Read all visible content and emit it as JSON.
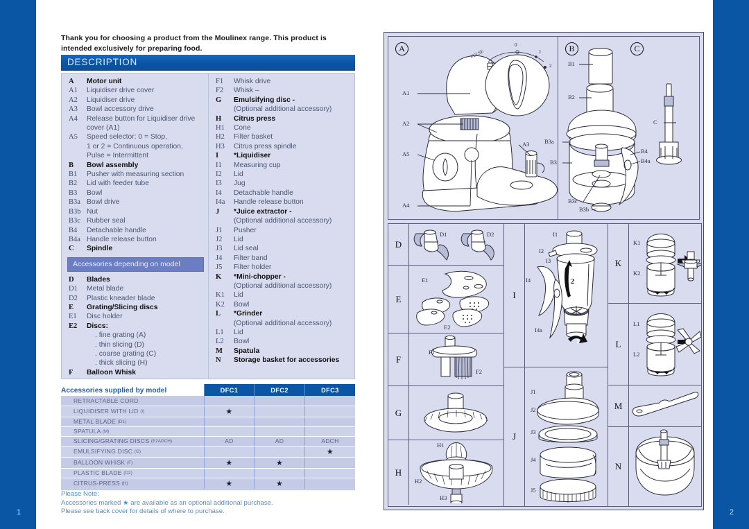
{
  "page": {
    "left_page_number": "1",
    "right_page_number": "2",
    "intro": "Thank you for choosing a product from the Moulinex range. This product is intended exclusively for preparing food.",
    "section_title": "DESCRIPTION"
  },
  "description": {
    "left_column": [
      {
        "code": "A",
        "text": "Motor unit",
        "bold": true
      },
      {
        "code": "A1",
        "text": "Liquidiser drive cover"
      },
      {
        "code": "A2",
        "text": "Liquidiser drive"
      },
      {
        "code": "A3",
        "text": "Bowl accessory drive"
      },
      {
        "code": "A4",
        "text": "Release button for Liquidiser drive"
      },
      {
        "code": "",
        "text": "cover (A1)"
      },
      {
        "code": "A5",
        "text": "Speed selector: 0 = Stop,"
      },
      {
        "code": "",
        "text": "1 or 2 = Continuous operation,"
      },
      {
        "code": "",
        "text": "Pulse = Intermittent"
      },
      {
        "code": "B",
        "text": "Bowl assembly",
        "bold": true
      },
      {
        "code": "B1",
        "text": "Pusher with measuring section"
      },
      {
        "code": "B2",
        "text": "Lid with feeder tube"
      },
      {
        "code": "B3",
        "text": "Bowl"
      },
      {
        "code": "B3a",
        "text": "Bowl drive"
      },
      {
        "code": "B3b",
        "text": "Nut"
      },
      {
        "code": "B3c",
        "text": "Rubber seal"
      },
      {
        "code": "B4",
        "text": "Detachable handle"
      },
      {
        "code": "B4a",
        "text": "Handle release button"
      },
      {
        "code": "C",
        "text": "Spindle",
        "bold": true
      }
    ],
    "band_label": "Accessories depending on model",
    "left_column_after_band": [
      {
        "code": "D",
        "text": "Blades",
        "bold": true
      },
      {
        "code": "D1",
        "text": "Metal blade"
      },
      {
        "code": "D2",
        "text": "Plastic kneader blade"
      },
      {
        "code": "E",
        "text": "Grating/Slicing discs",
        "bold": true
      },
      {
        "code": "E1",
        "text": "Disc holder"
      },
      {
        "code": "E2",
        "text": "Discs:",
        "bold": true
      },
      {
        "code": "",
        "text": ". fine grating (A)",
        "sub": true
      },
      {
        "code": "",
        "text": ". thin slicing (D)",
        "sub": true
      },
      {
        "code": "",
        "text": ". coarse grating (C)",
        "sub": true
      },
      {
        "code": "",
        "text": ". thick slicing (H)",
        "sub": true
      },
      {
        "code": "F",
        "text": "Balloon Whisk",
        "bold": true
      }
    ],
    "right_column": [
      {
        "code": "F1",
        "text": "Whisk drive"
      },
      {
        "code": "F2",
        "text": "Whisk –"
      },
      {
        "code": "G",
        "text": "Emulsifying disc -",
        "bold": true
      },
      {
        "code": "",
        "text": "(Optional additional accessory)"
      },
      {
        "code": "H",
        "text": "Citrus press",
        "bold": true
      },
      {
        "code": "H1",
        "text": "Cone"
      },
      {
        "code": "H2",
        "text": "Filter basket"
      },
      {
        "code": "H3",
        "text": "Citrus press spindle"
      },
      {
        "code": "I",
        "text": "*Liquidiser",
        "bold": true
      },
      {
        "code": "I1",
        "text": "Measuring cup"
      },
      {
        "code": "I2",
        "text": "Lid"
      },
      {
        "code": "I3",
        "text": "Jug"
      },
      {
        "code": "I4",
        "text": "Detachable handle"
      },
      {
        "code": "I4a",
        "text": "Handle release button"
      },
      {
        "code": "J",
        "text": "*Juice extractor -",
        "bold": true
      },
      {
        "code": "",
        "text": "(Optional additional accessory)"
      },
      {
        "code": "J1",
        "text": "Pusher"
      },
      {
        "code": "J2",
        "text": "Lid"
      },
      {
        "code": "J3",
        "text": "Lid seal"
      },
      {
        "code": "J4",
        "text": "Filter band"
      },
      {
        "code": "J5",
        "text": "Filter holder"
      },
      {
        "code": "K",
        "text": "*Mini-chopper -",
        "bold": true
      },
      {
        "code": "",
        "text": "(Optional additional accessory)"
      },
      {
        "code": "K1",
        "text": "Lid"
      },
      {
        "code": "K2",
        "text": "Bowl"
      },
      {
        "code": "L",
        "text": "*Grinder",
        "bold": true
      },
      {
        "code": "",
        "text": "(Optional additional accessory)"
      },
      {
        "code": "L1",
        "text": "Lid"
      },
      {
        "code": "L2",
        "text": "Bowl"
      },
      {
        "code": "M",
        "text": "Spatula",
        "bold": true
      },
      {
        "code": "N",
        "text": "Storage basket for accessories",
        "bold": true
      }
    ]
  },
  "accessories_table": {
    "title": "Accessories supplied by model",
    "columns": [
      "DFC1",
      "DFC2",
      "DFC3"
    ],
    "rows": [
      {
        "label": "RETRACTABLE CORD",
        "sub": "",
        "values": [
          "",
          "",
          ""
        ]
      },
      {
        "label": "LIQUIDISER WITH LID",
        "sub": "(I)",
        "values": [
          "★",
          "",
          ""
        ]
      },
      {
        "label": "METAL BLADE",
        "sub": "(D1)",
        "values": [
          "",
          "",
          ""
        ]
      },
      {
        "label": "SPATULA",
        "sub": "(M)",
        "values": [
          "",
          "",
          ""
        ]
      },
      {
        "label": "SLICING/GRATING DISCS",
        "sub": "(E2ADCH)",
        "values": [
          "AD",
          "AD",
          "ADCH"
        ]
      },
      {
        "label": "EMULSIFYING DISC",
        "sub": "(G)",
        "values": [
          "",
          "",
          "★"
        ]
      },
      {
        "label": "BALLOON WHISK",
        "sub": "(F)",
        "values": [
          "★",
          "★",
          ""
        ]
      },
      {
        "label": "PLASTIC BLADE",
        "sub": "(D2)",
        "values": [
          "",
          "",
          ""
        ]
      },
      {
        "label": "CITRUS-PRESS",
        "sub": "(H)",
        "values": [
          "★",
          "★",
          ""
        ]
      }
    ]
  },
  "note": {
    "line1": "Please Note:",
    "line2": "Accessories marked ★ are available as an optional additional purchase.",
    "line3": "Please see back cover for details of where to purchase."
  },
  "diagram": {
    "panels": {
      "A": "A",
      "B": "B",
      "C": "C",
      "D": "D",
      "E": "E",
      "F": "F",
      "G": "G",
      "H": "H",
      "I": "I",
      "J": "J",
      "K": "K",
      "L": "L",
      "M": "M",
      "N": "N"
    },
    "callouts_A": [
      "A1",
      "A2",
      "A5",
      "A4",
      "A3"
    ],
    "dial": {
      "pulse": "PULSE",
      "zero": "0",
      "one": "1",
      "two": "2"
    },
    "callouts_B": [
      "B1",
      "B2",
      "B3a",
      "B3",
      "B4",
      "B4a",
      "B3c",
      "B3b"
    ],
    "callouts_C": [
      "C"
    ],
    "callouts_D": [
      "D1",
      "D2"
    ],
    "callouts_E": [
      "E1",
      "E2"
    ],
    "callouts_F": [
      "F1",
      "F2"
    ],
    "callouts_H": [
      "H1",
      "H2",
      "H3"
    ],
    "callouts_I": [
      "I1",
      "I2",
      "I3",
      "I4",
      "I4a",
      "1",
      "2"
    ],
    "callouts_J": [
      "J1",
      "J2",
      "J3",
      "J4",
      "J5"
    ],
    "callouts_K": [
      "K1",
      "K2"
    ],
    "callouts_L": [
      "L1",
      "L2"
    ]
  },
  "colors": {
    "brand_blue": "#0b55a5",
    "panel_bg": "#d8dcee",
    "band_blue": "#6b7ec4",
    "note_blue": "#4d8fd0",
    "table_row": "#c5cbe6"
  }
}
